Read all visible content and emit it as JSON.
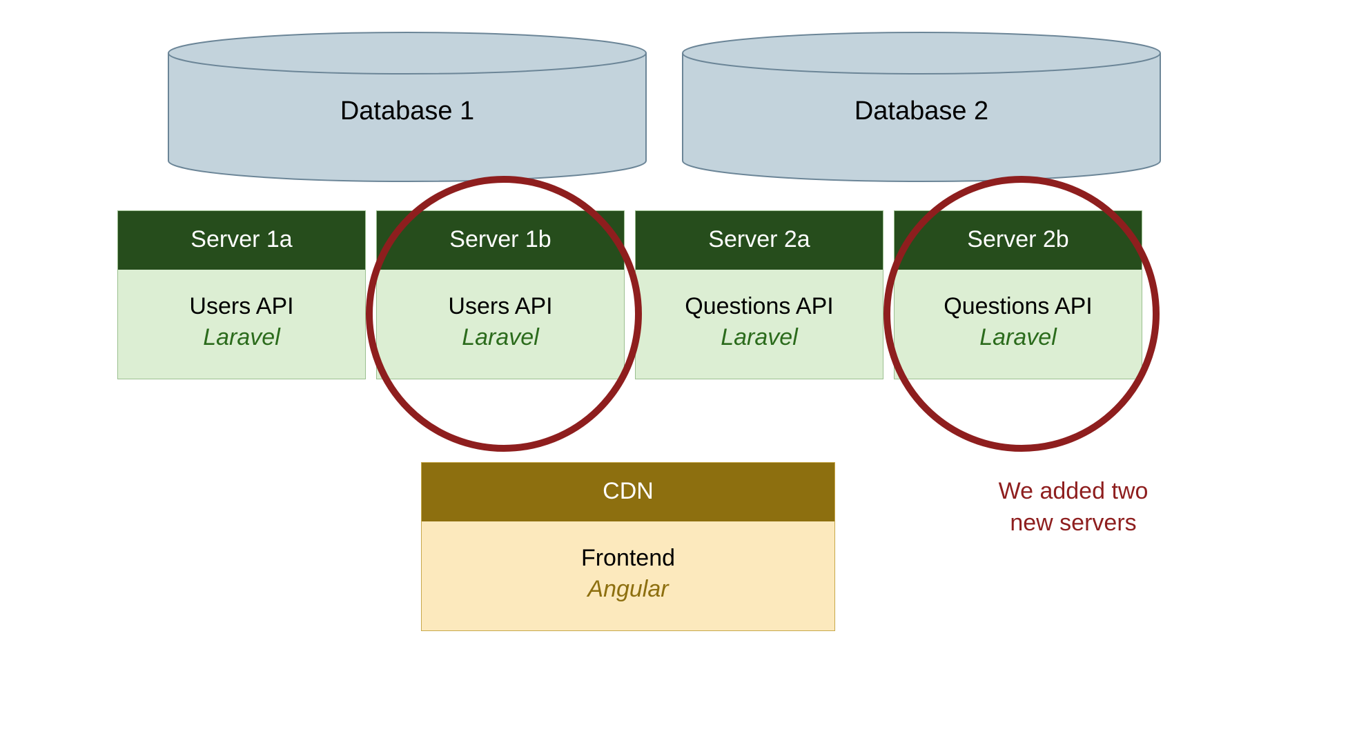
{
  "databases": [
    {
      "label": "Database 1"
    },
    {
      "label": "Database 2"
    }
  ],
  "servers": [
    {
      "name": "Server 1a",
      "api": "Users API",
      "tech": "Laravel"
    },
    {
      "name": "Server 1b",
      "api": "Users API",
      "tech": "Laravel"
    },
    {
      "name": "Server 2a",
      "api": "Questions API",
      "tech": "Laravel"
    },
    {
      "name": "Server 2b",
      "api": "Questions API",
      "tech": "Laravel"
    }
  ],
  "cdn": {
    "header": "CDN",
    "api": "Frontend",
    "tech": "Angular"
  },
  "annotation": {
    "line1": "We added two",
    "line2": "new servers"
  },
  "colors": {
    "cylinderFill": "#c3d3dc",
    "cylinderStroke": "#6b8597",
    "serverHeader": "#264d1c",
    "serverBody": "#dceed3",
    "serverBorder": "#9bbf8f",
    "serverTech": "#2b6b1c",
    "cdnHeader": "#8d6f0f",
    "cdnBody": "#fce9bd",
    "cdnBorder": "#c7a84a",
    "circle": "#8e1e1e"
  }
}
